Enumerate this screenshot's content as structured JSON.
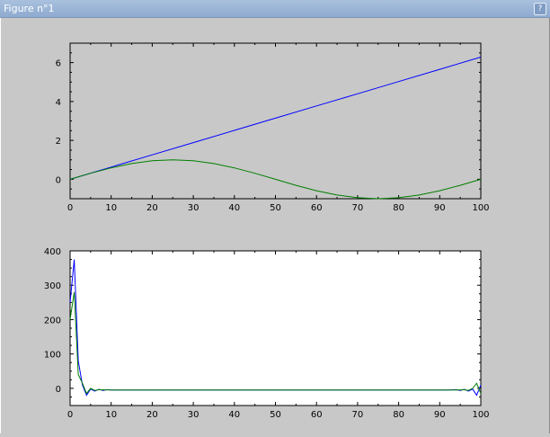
{
  "window": {
    "title": "Figure n°1",
    "help_label": "?"
  },
  "chart_data": [
    {
      "type": "line",
      "title": "",
      "xlabel": "",
      "ylabel": "",
      "xlim": [
        0,
        100
      ],
      "ylim": [
        -1,
        7
      ],
      "x_ticks": [
        0,
        10,
        20,
        30,
        40,
        50,
        60,
        70,
        80,
        90,
        100
      ],
      "y_ticks": [
        0,
        2,
        4,
        6
      ],
      "background": "#c8c8c8",
      "series": [
        {
          "color": "#0000ff",
          "expr": "t = 2*pi*x/100",
          "x": [
            0,
            10,
            20,
            30,
            40,
            50,
            60,
            70,
            80,
            90,
            100
          ],
          "values": [
            0,
            0.628,
            1.257,
            1.885,
            2.513,
            3.142,
            3.77,
            4.398,
            5.027,
            5.655,
            6.283
          ]
        },
        {
          "color": "#007f00",
          "expr": "sin(2*pi*x/100)",
          "x": [
            0,
            5,
            10,
            15,
            20,
            25,
            30,
            35,
            40,
            45,
            50,
            55,
            60,
            65,
            70,
            75,
            80,
            85,
            90,
            95,
            100
          ],
          "values": [
            0,
            0.309,
            0.588,
            0.809,
            0.951,
            1.0,
            0.951,
            0.809,
            0.588,
            0.309,
            0,
            -0.309,
            -0.588,
            -0.809,
            -0.951,
            -1.0,
            -0.951,
            -0.809,
            -0.588,
            -0.309,
            0
          ]
        }
      ]
    },
    {
      "type": "line",
      "title": "",
      "xlabel": "",
      "ylabel": "",
      "xlim": [
        0,
        100
      ],
      "ylim": [
        -50,
        400
      ],
      "x_ticks": [
        0,
        10,
        20,
        30,
        40,
        50,
        60,
        70,
        80,
        90,
        100
      ],
      "y_ticks": [
        0,
        100,
        200,
        300,
        400
      ],
      "background": "#ffffff",
      "series": [
        {
          "color": "#0000ff",
          "x": [
            0,
            1,
            2,
            3,
            4,
            5,
            6,
            7,
            8,
            9,
            10,
            15,
            20,
            30,
            50,
            70,
            90,
            92,
            94,
            95,
            96,
            97,
            98,
            99,
            100
          ],
          "values": [
            250,
            375,
            80,
            10,
            -20,
            -2,
            -8,
            -3,
            -6,
            -4,
            -5,
            -5,
            -5,
            -5,
            -5,
            -5,
            -5,
            -5,
            -4,
            -6,
            -3,
            -8,
            -2,
            -20,
            10
          ]
        },
        {
          "color": "#007f00",
          "x": [
            0,
            1,
            2,
            3,
            4,
            5,
            6,
            7,
            10,
            20,
            30,
            50,
            70,
            90,
            94,
            96,
            97,
            98,
            99,
            100
          ],
          "values": [
            200,
            280,
            40,
            15,
            -15,
            0,
            -6,
            -4,
            -5,
            -5,
            -5,
            -5,
            -5,
            -5,
            -5,
            -4,
            -6,
            0,
            15,
            -15
          ]
        }
      ]
    }
  ]
}
